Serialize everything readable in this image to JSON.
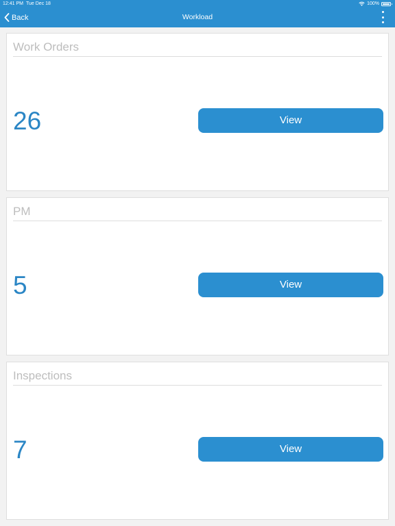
{
  "status_bar": {
    "time": "12:41 PM",
    "date": "Tue Dec 18",
    "battery": "100%"
  },
  "nav": {
    "back_label": "Back",
    "title": "Workload"
  },
  "cards": [
    {
      "title": "Work Orders",
      "count": "26",
      "button_label": "View"
    },
    {
      "title": "PM",
      "count": "5",
      "button_label": "View"
    },
    {
      "title": "Inspections",
      "count": "7",
      "button_label": "View"
    }
  ],
  "colors": {
    "accent": "#2b8fd0",
    "count_text": "#2b86c5",
    "title_text": "#bdbdbd"
  }
}
